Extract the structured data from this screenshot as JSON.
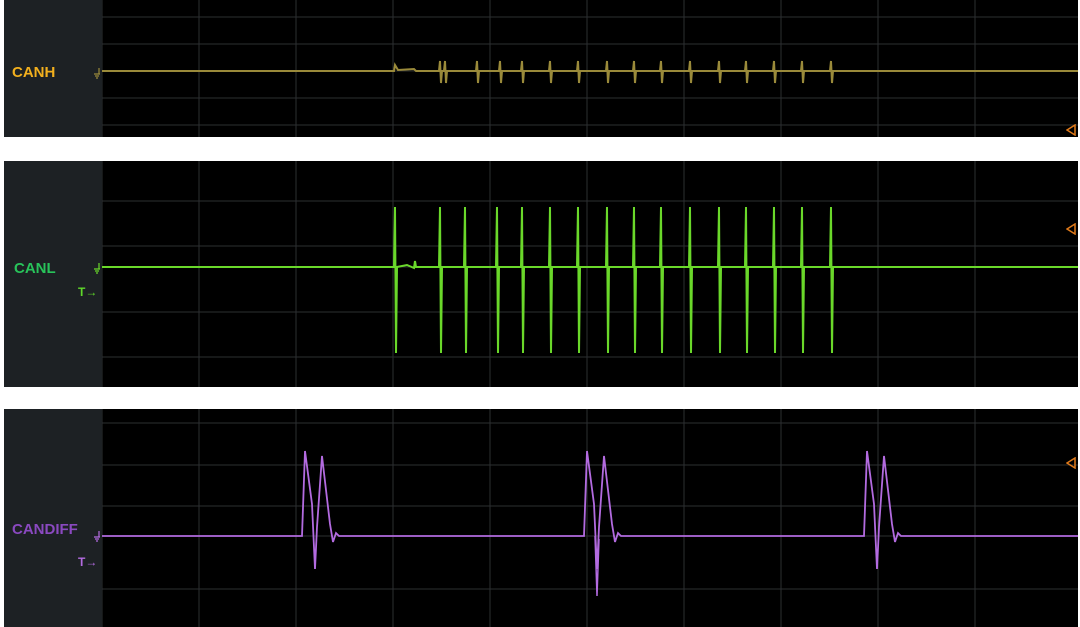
{
  "channels": [
    {
      "id": "canh",
      "label": "CANH",
      "color": "#c9a227",
      "trace_color": "#9a8a3a",
      "label_color": "#f2b01e",
      "has_trigger_label": false,
      "trigger_label": ""
    },
    {
      "id": "canl",
      "label": "CANL",
      "color": "#5fd82a",
      "trace_color": "#6ad82a",
      "label_color": "#28c35a",
      "has_trigger_label": true,
      "trigger_label": "T→"
    },
    {
      "id": "candiff",
      "label": "CANDIFF",
      "color": "#b36be0",
      "trace_color": "#b36be0",
      "label_color": "#8a49c0",
      "has_trigger_label": true,
      "trigger_label": "T→"
    }
  ],
  "grid_color": "#2c2f31",
  "marker_color": "#e07a1a"
}
